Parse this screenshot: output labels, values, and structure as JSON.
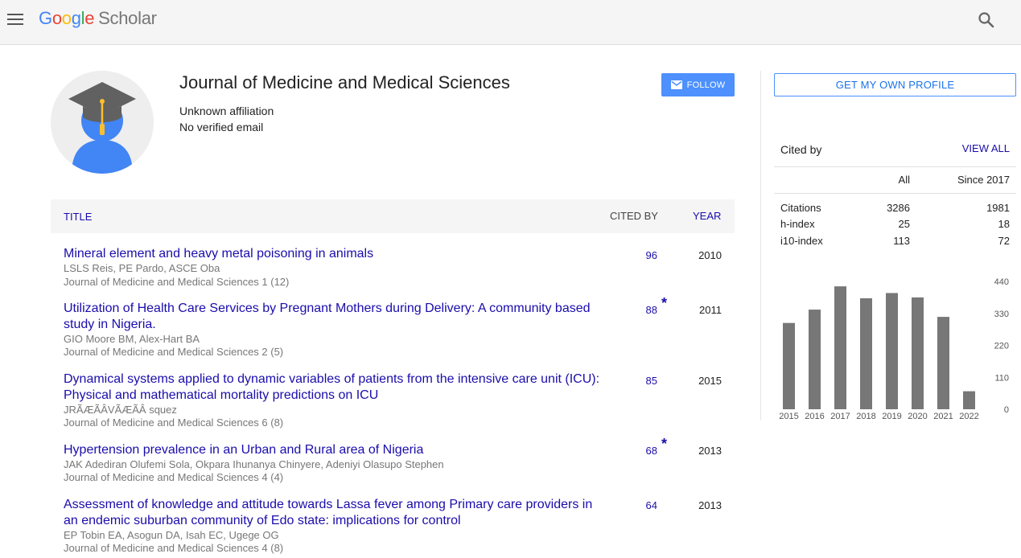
{
  "header": {
    "logo_letters": [
      "G",
      "o",
      "o",
      "g",
      "l",
      "e"
    ],
    "logo_scholar": "Scholar",
    "icons": [
      "menu-icon",
      "search-icon"
    ]
  },
  "profile": {
    "name": "Journal of Medicine and Medical Sciences",
    "affiliation": "Unknown affiliation",
    "email": "No verified email",
    "follow_label": "FOLLOW",
    "avatar_icon": "graduation-cap-person-icon"
  },
  "table": {
    "headers": {
      "title": "TITLE",
      "cited_by": "CITED BY",
      "year": "YEAR"
    },
    "articles": [
      {
        "title": "Mineral element and heavy metal poisoning in animals",
        "authors": "LSLS Reis, PE Pardo, ASCE Oba",
        "venue": "Journal of Medicine and Medical Sciences 1 (12)",
        "cited": "96",
        "star": "",
        "year": "2010"
      },
      {
        "title": "Utilization of Health Care Services by Pregnant Mothers during Delivery: A community based study in Nigeria.",
        "authors": "GIO Moore BM, Alex-Hart BA",
        "venue": "Journal of Medicine and Medical Sciences 2 (5)",
        "cited": "88",
        "star": "*",
        "year": "2011"
      },
      {
        "title": "Dynamical systems applied to dynamic variables of patients from the intensive care unit (ICU): Physical and mathematical mortality predictions on ICU",
        "authors": "JRÃÆÃÂVÃÆÃÂ squez",
        "venue": "Journal of Medicine and Medical Sciences 6 (8)",
        "cited": "85",
        "star": "",
        "year": "2015"
      },
      {
        "title": "Hypertension prevalence in an Urban and Rural area of Nigeria",
        "authors": "JAK Adediran Olufemi Sola, Okpara Ihunanya Chinyere, Adeniyi Olasupo Stephen",
        "venue": "Journal of Medicine and Medical Sciences 4 (4)",
        "cited": "68",
        "star": "*",
        "year": "2013"
      },
      {
        "title": "Assessment of knowledge and attitude towards Lassa fever among Primary care providers in an endemic suburban community of Edo state: implications for control",
        "authors": "EP Tobin EA, Asogun DA, Isah EC, Ugege OG",
        "venue": "Journal of Medicine and Medical Sciences 4 (8)",
        "cited": "64",
        "star": "",
        "year": "2013"
      }
    ]
  },
  "sidebar": {
    "get_profile_label": "GET MY OWN PROFILE",
    "cited_by_label": "Cited by",
    "view_all_label": "VIEW ALL",
    "col_all": "All",
    "col_since": "Since 2017",
    "stats": [
      {
        "label": "Citations",
        "all": "3286",
        "since": "1981"
      },
      {
        "label": "h-index",
        "all": "25",
        "since": "18"
      },
      {
        "label": "i10-index",
        "all": "113",
        "since": "72"
      }
    ]
  },
  "chart_data": {
    "type": "bar",
    "categories": [
      "2015",
      "2016",
      "2017",
      "2018",
      "2019",
      "2020",
      "2021",
      "2022"
    ],
    "values": [
      297,
      343,
      423,
      382,
      400,
      385,
      318,
      62
    ],
    "yticks": [
      "440",
      "330",
      "220",
      "110",
      "0"
    ],
    "ylim": [
      0,
      440
    ],
    "bar_color": "#777777",
    "title": "",
    "xlabel": "",
    "ylabel": ""
  },
  "colors": {
    "link": "#1a0dab",
    "accent": "#4d90fe",
    "muted": "#777777"
  }
}
